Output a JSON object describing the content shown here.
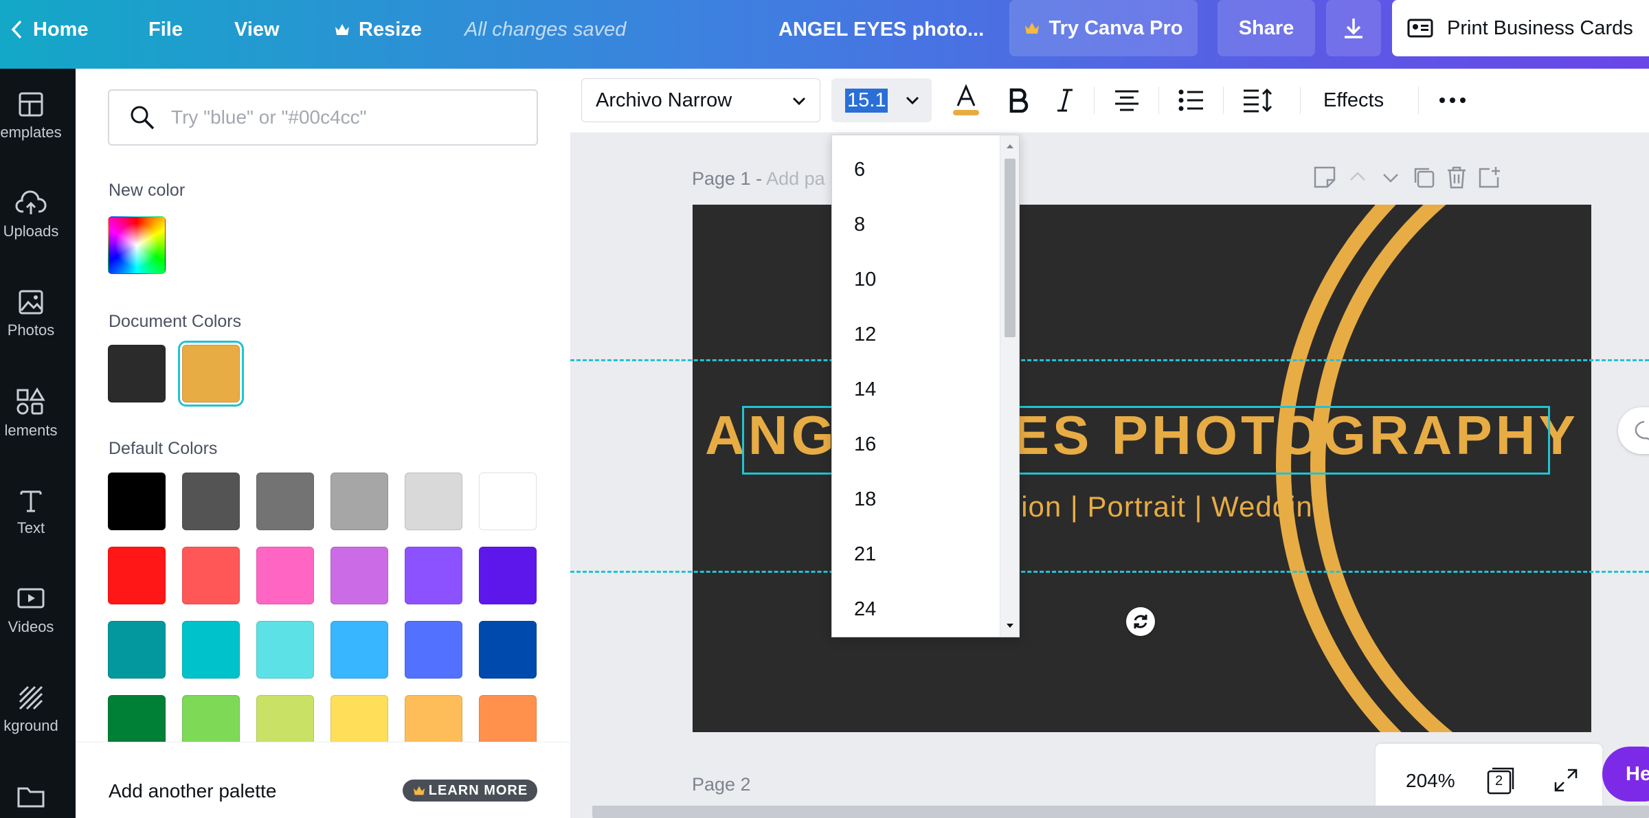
{
  "topbar": {
    "home": "Home",
    "file": "File",
    "view": "View",
    "resize": "Resize",
    "save_status": "All changes saved",
    "doc_title": "ANGEL EYES photo...",
    "try_pro": "Try Canva Pro",
    "share": "Share",
    "print": "Print Business Cards"
  },
  "rail": [
    {
      "label": "emplates",
      "icon": "templates-icon"
    },
    {
      "label": "Uploads",
      "icon": "upload-cloud-icon"
    },
    {
      "label": "Photos",
      "icon": "photo-icon"
    },
    {
      "label": "lements",
      "icon": "elements-icon"
    },
    {
      "label": "Text",
      "icon": "text-icon"
    },
    {
      "label": "Videos",
      "icon": "video-icon"
    },
    {
      "label": "kground",
      "icon": "background-icon"
    },
    {
      "label": "",
      "icon": "folder-icon"
    }
  ],
  "panel": {
    "search_placeholder": "Try \"blue\" or \"#00c4cc\"",
    "new_color_label": "New color",
    "document_colors_label": "Document Colors",
    "document_colors": [
      "#2b2b2b",
      "#e8ac44"
    ],
    "default_colors_label": "Default Colors",
    "default_colors": [
      [
        "#000000",
        "#545454",
        "#737373",
        "#a6a6a6",
        "#d9d9d9",
        "#ffffff"
      ],
      [
        "#ff1616",
        "#ff5757",
        "#ff66c4",
        "#cb6ce6",
        "#8c52ff",
        "#5e17eb"
      ],
      [
        "#03989e",
        "#00c2cb",
        "#5ce1e6",
        "#38b6ff",
        "#5271ff",
        "#004aad"
      ],
      [
        "#008037",
        "#7ed957",
        "#c9e265",
        "#ffde59",
        "#ffbd59",
        "#ff914d"
      ]
    ],
    "add_palette": "Add another palette",
    "learn_more": "LEARN MORE"
  },
  "toolbar": {
    "font": "Archivo Narrow",
    "size": "15.1",
    "effects": "Effects",
    "text_color": "#e8ac44"
  },
  "size_options": [
    "6",
    "8",
    "10",
    "12",
    "14",
    "16",
    "18",
    "21",
    "24"
  ],
  "canvas": {
    "page1_label": "Page 1 - ",
    "page1_placeholder": "Add pa",
    "card_title": "ANGEL EYES PHOTOGRAPHY",
    "card_subtitle": "Fashion | Portrait | Wedding",
    "page2_label": "Page 2",
    "zoom": "204%",
    "page_count": "2",
    "help": "He",
    "accent": "#e8ac44",
    "card_bg": "#2b2b2b"
  }
}
